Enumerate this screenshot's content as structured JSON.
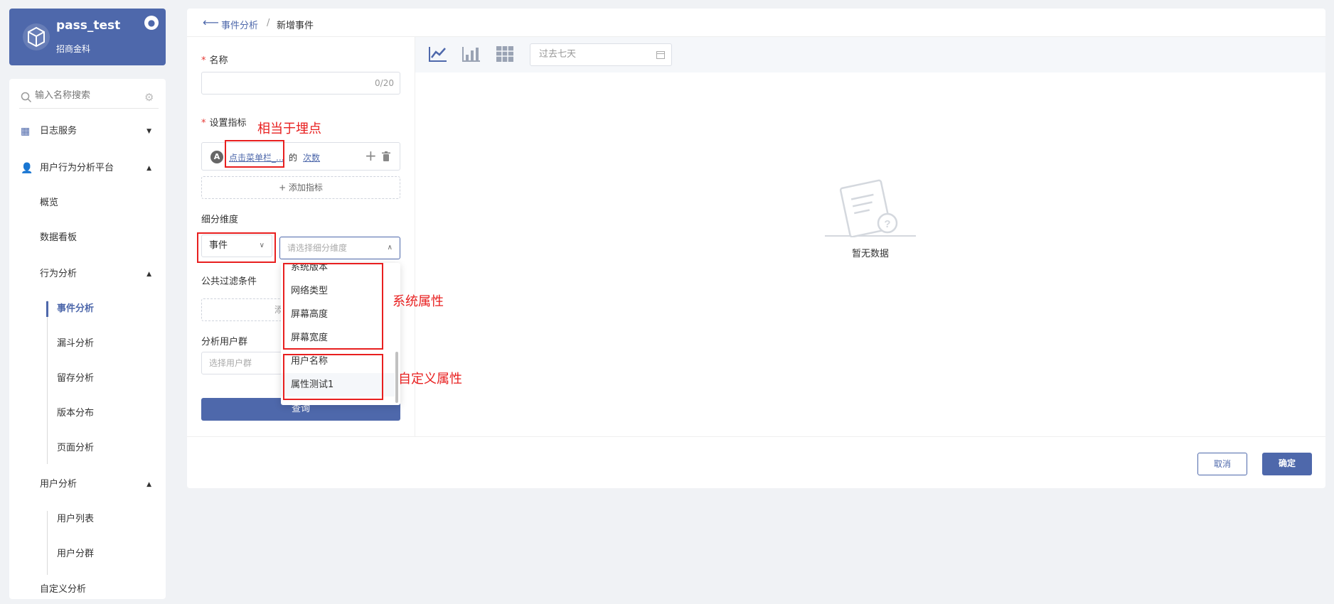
{
  "brand": {
    "title": "pass_test",
    "subtitle": "招商金科"
  },
  "sidebar": {
    "search_placeholder": "输入名称搜索",
    "items": [
      {
        "label": "日志服务"
      },
      {
        "label": "用户行为分析平台"
      },
      {
        "label": "概览"
      },
      {
        "label": "数据看板"
      },
      {
        "label": "行为分析"
      },
      {
        "label": "事件分析"
      },
      {
        "label": "漏斗分析"
      },
      {
        "label": "留存分析"
      },
      {
        "label": "版本分布"
      },
      {
        "label": "页面分析"
      },
      {
        "label": "用户分析"
      },
      {
        "label": "用户列表"
      },
      {
        "label": "用户分群"
      },
      {
        "label": "自定义分析"
      }
    ]
  },
  "breadcrumb": {
    "parent": "事件分析",
    "separator": "/",
    "current": "新增事件"
  },
  "form": {
    "name_label": "名称",
    "name_counter": "0/20",
    "metric_label": "设置指标",
    "metric_badge": "A",
    "metric_event": "点击菜单栏_...",
    "metric_of": "的",
    "metric_measure": "次数",
    "add_metric": "+ 添加指标",
    "dimension_label": "细分维度",
    "dimension_type": "事件",
    "dimension_placeholder": "请选择细分维度",
    "filter_label": "公共过滤条件",
    "filter_add_fragment": "添",
    "user_group_label": "分析用户群",
    "user_group_placeholder": "选择用户群",
    "query_button": "查询"
  },
  "dropdown": {
    "options": [
      "系统版本",
      "网络类型",
      "屏幕高度",
      "屏幕宽度",
      "用户名称",
      "属性测试1"
    ]
  },
  "annotations": {
    "tracking_point": "相当于埋点",
    "system_attrs": "系统属性",
    "custom_attrs": "自定义属性"
  },
  "chart_panel": {
    "date_placeholder": "过去七天",
    "empty_text": "暂无数据"
  },
  "footer": {
    "cancel": "取消",
    "confirm": "确定"
  },
  "colors": {
    "primary": "#4e68ab",
    "annotation": "#e81f1f"
  }
}
